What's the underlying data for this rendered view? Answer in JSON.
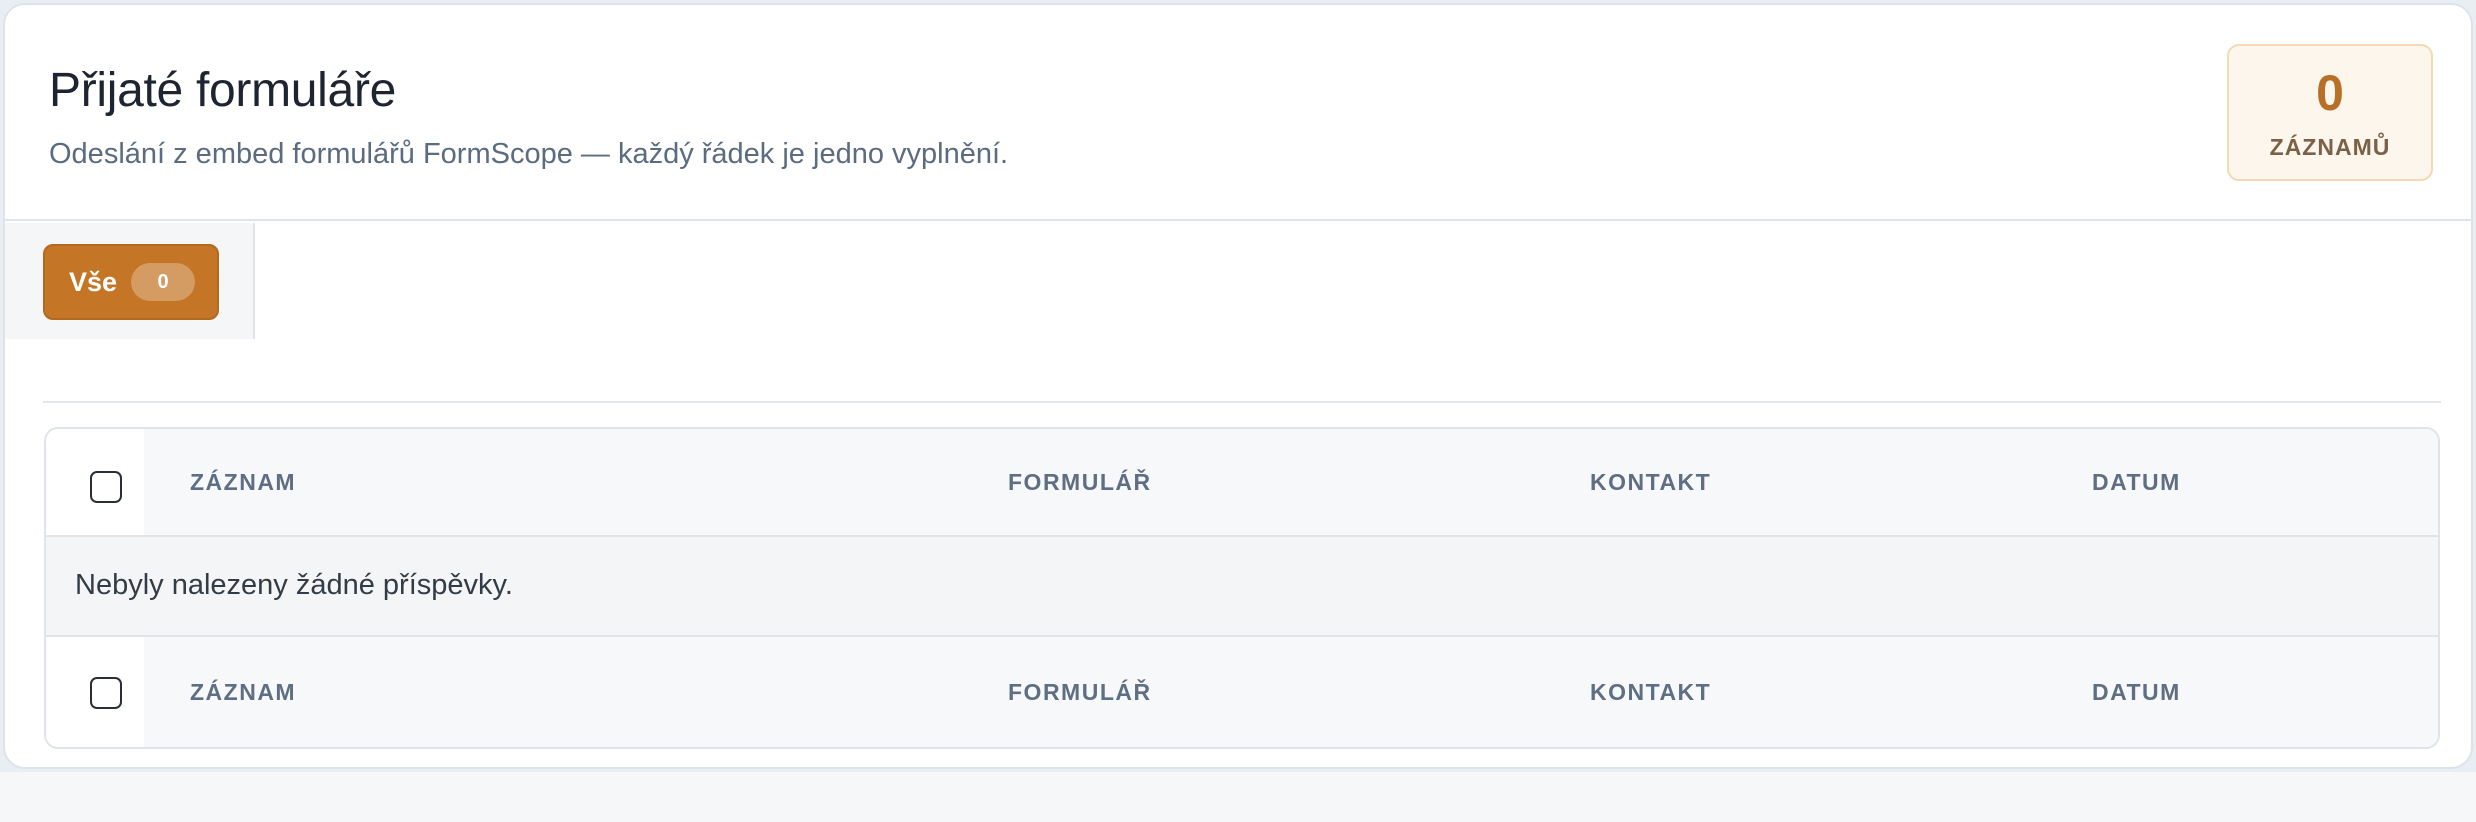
{
  "header": {
    "title": "Přijaté formuláře",
    "subtitle": "Odeslání z embed formulářů FormScope — každý řádek je jedno vyplnění.",
    "count": {
      "value": "0",
      "label": "ZÁZNAMŮ"
    }
  },
  "filters": {
    "items": [
      {
        "label": "Vše",
        "count": "0",
        "active": true
      }
    ]
  },
  "table": {
    "columns": [
      "ZÁZNAM",
      "FORMULÁŘ",
      "KONTAKT",
      "DATUM"
    ],
    "empty_message": "Nebyly nalezeny žádné příspěvky.",
    "rows": []
  },
  "colors": {
    "accent": "#c47626",
    "count_value": "#b87026"
  }
}
